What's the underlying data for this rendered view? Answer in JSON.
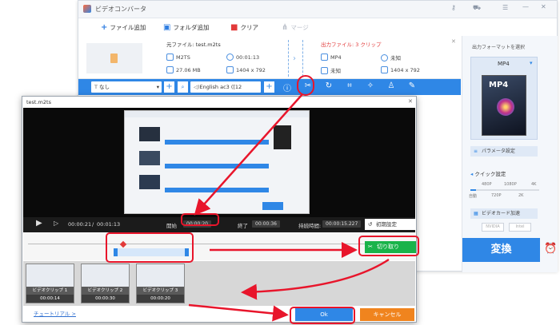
{
  "app": {
    "title": "ビデオコンバータ"
  },
  "toolbar": {
    "add_file": "ファイル追加",
    "add_folder": "フォルダ追加",
    "clear": "クリア",
    "merge": "マージ"
  },
  "file": {
    "source_label": "元ファイル: test.m2ts",
    "source_format": "M2TS",
    "source_duration": "00:01:13",
    "source_size": "27.06 MB",
    "source_resolution": "1404 x 792",
    "output_label": "出力ファイル: 3 クリップ",
    "output_format": "MP4",
    "output_duration": "未知",
    "output_size": "未知",
    "output_resolution": "1404 x 792"
  },
  "editbar": {
    "subtitle": "なし",
    "audio": "English ac3 ([12"
  },
  "panel": {
    "title": "出力フォーマットを選択",
    "format": "MP4",
    "param_button": "パラメータ設定",
    "quick_title": "クイック設定",
    "quality_top": [
      "480P",
      "1080P",
      "4K"
    ],
    "quality_bottom": [
      "自動",
      "720P",
      "2K"
    ],
    "gpu": "ビデオカード加速",
    "gpu_brands": [
      "NVIDIA",
      "Intel"
    ],
    "convert": "変換"
  },
  "dialog": {
    "title": "test.m2ts",
    "current_time": "00:00:21",
    "total_time": "00:01:13",
    "start_label": "開始",
    "start_value": "00:00:20",
    "end_label": "終了",
    "end_value": "00:00:36",
    "duration_label": "持続時間:",
    "duration_value": "00:00:15.227",
    "reset": "初期設定",
    "cut": "切り取り",
    "tutorial": "チュートリアル >",
    "ok": "Ok",
    "cancel": "キャンセル",
    "clips": [
      {
        "label": "ビデオクリップ 1",
        "time": "00:00:14"
      },
      {
        "label": "ビデオクリップ 2",
        "time": "00:00:30"
      },
      {
        "label": "ビデオクリップ 3",
        "time": "00:00:20"
      }
    ]
  },
  "colors": {
    "accent": "#2f87e6",
    "annotation": "#e8152b",
    "cut_button": "#19b34a",
    "cancel": "#f0841e"
  }
}
